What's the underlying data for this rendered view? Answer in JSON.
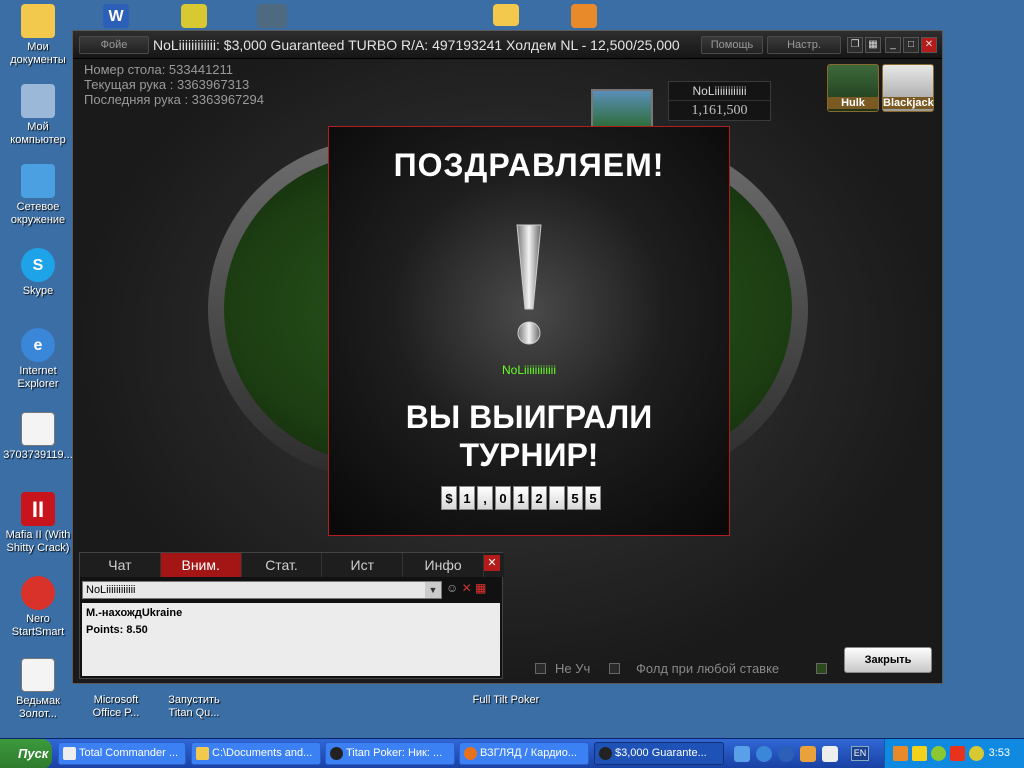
{
  "desktop": {
    "icons": [
      {
        "label": "Мои документы"
      },
      {
        "label": "Мой компьютер"
      },
      {
        "label": "Сетевое окружение"
      },
      {
        "label": "Skype"
      },
      {
        "label": "Internet Explorer"
      },
      {
        "label": "3703739119..."
      },
      {
        "label": "Mafia II (With Shitty Crack)"
      },
      {
        "label": "Nero StartSmart"
      },
      {
        "label": "Ведьмак Золот..."
      },
      {
        "label": "Microsoft Office P..."
      },
      {
        "label": "Запустить Titan Qu..."
      },
      {
        "label": "Full Tilt Poker"
      }
    ]
  },
  "window": {
    "lobby_button": "Фойе",
    "title": "NoLiiiiiiiiiiii: $3,000 Guaranteed TURBO R/A: 497193241 Холдем NL - 12,500/25,000",
    "help_button": "Помощь",
    "settings_button": "Настр."
  },
  "table_info": {
    "table_number": "Номер стола: 533441211",
    "current_hand": "Текущая рука : 3363967313",
    "last_hand": "Последняя рука : 3363967294"
  },
  "player": {
    "name": "NoLiiiiiiiiiiii",
    "chips": "1,161,500"
  },
  "corner_buttons": {
    "hulk": "Hulk",
    "blackjack": "Blackjack"
  },
  "popup": {
    "title": "ПОЗДРАВЛЯЕМ!",
    "user": "NoLiiiiiiiiiiii",
    "message_line1": "ВЫ ВЫИГРАЛИ",
    "message_line2": "ТУРНИР!",
    "prize": [
      "$",
      "1",
      ",",
      "0",
      "1",
      "2",
      ".",
      "5",
      "5"
    ]
  },
  "chat": {
    "tabs": [
      "Чат",
      "Вним.",
      "Стат.",
      "Ист",
      "Инфо"
    ],
    "active_tab": "Вним.",
    "selected_player": "NoLiiiiiiiiiiii",
    "log": [
      "М.-нахождUkraine",
      "Points: 8.50"
    ]
  },
  "options": {
    "sit_out": "Не Уч",
    "fold_any": "Фолд при любой ставке"
  },
  "close_button": "Закрыть",
  "taskbar": {
    "start": "Пуск",
    "tasks": [
      {
        "label": "Total Commander ...",
        "active": false
      },
      {
        "label": "C:\\Documents and...",
        "active": false
      },
      {
        "label": "Titan Poker: Ник: ...",
        "active": false
      },
      {
        "label": "ВЗГЛЯД / Кардио...",
        "active": false
      },
      {
        "label": "$3,000 Guarante...",
        "active": true
      }
    ],
    "lang": "EN",
    "clock": "3:53"
  }
}
